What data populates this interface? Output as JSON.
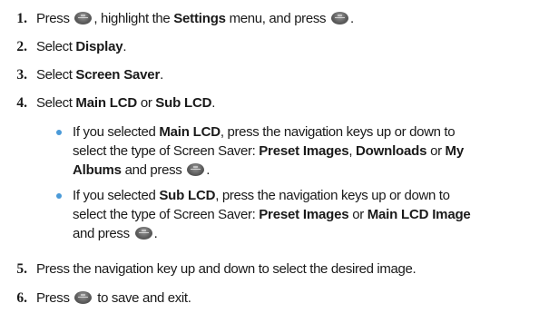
{
  "steps": [
    {
      "num": "1.",
      "parts": [
        "Press",
        ", highlight the",
        "Settings",
        "menu, and press",
        "."
      ]
    },
    {
      "num": "2.",
      "parts": [
        "Select",
        "Display",
        "."
      ]
    },
    {
      "num": "3.",
      "parts": [
        "Select",
        "Screen Saver",
        "."
      ]
    },
    {
      "num": "4.",
      "parts": [
        "Select",
        "Main LCD",
        "or",
        "Sub LCD",
        "."
      ]
    },
    {
      "num": "5.",
      "parts": [
        "Press the navigation key up and down to select the desired image."
      ]
    },
    {
      "num": "6.",
      "parts": [
        "Press",
        "to save and exit."
      ]
    }
  ],
  "bullets": [
    {
      "l1": [
        "If you selected",
        "Main LCD",
        ", press the navigation keys up or down to"
      ],
      "l2": [
        "select the type of Screen Saver:",
        "Preset Images",
        ",",
        "Downloads",
        "or",
        "My"
      ],
      "l3": [
        "Albums",
        "and press",
        "."
      ]
    },
    {
      "l1": [
        "If you selected",
        "Sub LCD",
        ", press the navigation keys up or down to"
      ],
      "l2": [
        "select the type of Screen Saver:",
        "Preset Images",
        "or",
        "Main LCD Image"
      ],
      "l3": [
        "and press",
        "."
      ]
    }
  ],
  "icons": {
    "menu_ok_key": "menu-ok-key-icon",
    "bullet_color": "#4a9ad8"
  }
}
